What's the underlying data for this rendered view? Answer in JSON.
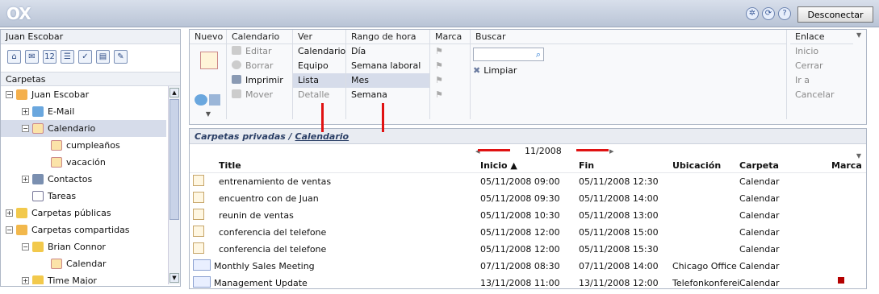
{
  "logo": "OX",
  "logout_label": "Desconectar",
  "left": {
    "user": "Juan Escobar",
    "folders_label": "Carpetas",
    "modules": [
      "home-icon",
      "mail-icon",
      "calendar-icon",
      "contacts-icon",
      "tasks-icon",
      "infostore-icon",
      "settings-icon"
    ],
    "tree": [
      {
        "label": "Juan Escobar",
        "indent": 0
      },
      {
        "label": "E-Mail",
        "indent": 1
      },
      {
        "label": "Calendario",
        "indent": 1
      },
      {
        "label": "cumpleaños",
        "indent": 2
      },
      {
        "label": "vacación",
        "indent": 2
      },
      {
        "label": "Contactos",
        "indent": 1
      },
      {
        "label": "Tareas",
        "indent": 1
      },
      {
        "label": "Carpetas públicas",
        "indent": 0
      },
      {
        "label": "Carpetas compartidas",
        "indent": 0
      },
      {
        "label": "Brian Connor",
        "indent": 1
      },
      {
        "label": "Calendar",
        "indent": 2
      },
      {
        "label": "Time Major",
        "indent": 1
      }
    ]
  },
  "toolbar": {
    "nuevo": "Nuevo",
    "calendario": {
      "head": "Calendario",
      "items": [
        "Editar",
        "Borrar",
        "Imprimir",
        "Mover"
      ]
    },
    "ver": {
      "head": "Ver",
      "items": [
        "Calendario",
        "Equipo",
        "Lista",
        "Detalle"
      ]
    },
    "rango": {
      "head": "Rango de hora",
      "items": [
        "Día",
        "Semana laboral",
        "Mes",
        "Semana"
      ]
    },
    "marca": "Marca",
    "buscar": {
      "head": "Buscar",
      "clear": "Limpiar"
    },
    "enlace": {
      "head": "Enlace",
      "items": [
        "Inicio",
        "Cerrar",
        "Ir a",
        "Cancelar"
      ]
    }
  },
  "main": {
    "crumb_prefix": "Carpetas privadas / ",
    "crumb_link": "Calendario",
    "month": "11/2008",
    "columns": {
      "title": "Title",
      "start": "Inicio ▲",
      "end": "Fin",
      "location": "Ubicación",
      "folder": "Carpeta",
      "flag": "Marca"
    },
    "rows": [
      {
        "title": "entrenamiento de ventas",
        "start": "05/11/2008 09:00",
        "end": "05/11/2008 12:30",
        "location": "",
        "folder": "Calendar"
      },
      {
        "title": "encuentro con de Juan",
        "start": "05/11/2008 09:30",
        "end": "05/11/2008 14:00",
        "location": "",
        "folder": "Calendar"
      },
      {
        "title": "reunin de ventas",
        "start": "05/11/2008 10:30",
        "end": "05/11/2008 13:00",
        "location": "",
        "folder": "Calendar"
      },
      {
        "title": "conferencia del telefone",
        "start": "05/11/2008 12:00",
        "end": "05/11/2008 15:00",
        "location": "",
        "folder": "Calendar"
      },
      {
        "title": "conferencia del telefone",
        "start": "05/11/2008 12:00",
        "end": "05/11/2008 15:30",
        "location": "",
        "folder": "Calendar"
      },
      {
        "title": "Monthly Sales Meeting",
        "start": "07/11/2008 08:30",
        "end": "07/11/2008 14:00",
        "location": "Chicago Office",
        "folder": "Calendar"
      },
      {
        "title": "Management Update",
        "start": "13/11/2008 11:00",
        "end": "13/11/2008 12:00",
        "location": "Telefonkonferei",
        "folder": "Calendar"
      }
    ]
  }
}
